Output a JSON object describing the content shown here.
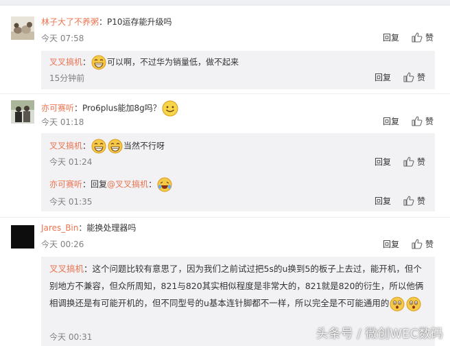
{
  "actions": {
    "reply_label": "回复",
    "like_label": "赞"
  },
  "comments": [
    {
      "user": "林子大了不养粥",
      "text": "P10运存能升级吗",
      "time": "今天 07:58",
      "replies": [
        {
          "user": "叉叉搞机",
          "text": "可以啊，不过华为销量低，做不起来",
          "time": "15分钟前",
          "emoji": "grin-emoji"
        }
      ]
    },
    {
      "user": "亦可赛听",
      "text": "Pro6plus能加8g吗？",
      "time": "今天 01:18",
      "replies": [
        {
          "user": "叉叉搞机",
          "text": "当然不行呀",
          "time": "今天 01:24",
          "emoji": "grin-emoji"
        },
        {
          "user": "亦可赛听",
          "text": "回复",
          "mention": "@叉叉搞机",
          "time": "今天 01:35",
          "emoji": "laugh-cry-emoji"
        }
      ]
    },
    {
      "user": "Jares_Bin",
      "text": "能换处理器吗",
      "time": "今天 00:26",
      "replies": [
        {
          "user": "叉叉搞机",
          "text": "这个问题比较有意思了，因为我们之前试过把5s的u换到5的板子上去过，能开机，但个别地方不兼容，但众所周知，821与820其实相似程度是非常大的，821就是820的衍生，所以他俩相调换还是有可能开机的，但不同型号的u基本连针脚都不一样，所以完全是不可能通用的",
          "time": "今天 00:31",
          "emoji": "surprised-emoji"
        }
      ]
    }
  ],
  "colon": "：",
  "watermark": "头条号 / 微创WEC数码",
  "colors": {
    "username": "#eb7350",
    "reply_bg": "#f2f2f5",
    "time": "#808080"
  }
}
